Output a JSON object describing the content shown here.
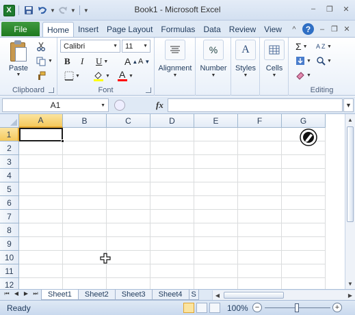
{
  "window": {
    "title": "Book1 - Microsoft Excel",
    "app_icon": "excel-icon",
    "minimize": "–",
    "restore": "❐",
    "close": "✕"
  },
  "qat": {
    "save_icon": "save-icon",
    "undo_icon": "undo-icon",
    "redo_icon": "redo-icon",
    "customize_icon": "customize-qat-icon"
  },
  "ribbon_tabs": {
    "file": "File",
    "tabs": [
      "Home",
      "Insert",
      "Page Layout",
      "Formulas",
      "Data",
      "Review",
      "View"
    ],
    "active": "Home"
  },
  "ribbon": {
    "clipboard": {
      "label": "Clipboard",
      "paste": "Paste"
    },
    "font": {
      "label": "Font",
      "font_name": "Calibri",
      "font_size": "11",
      "bold": "B",
      "italic": "I",
      "underline": "U",
      "grow": "A",
      "shrink": "A",
      "font_color": "A",
      "fill_color": "#ffff00",
      "text_color": "#ff0000"
    },
    "alignment": {
      "label": "Alignment"
    },
    "number": {
      "label": "Number",
      "symbol": "%"
    },
    "styles": {
      "label": "Styles",
      "symbol": "A"
    },
    "cells": {
      "label": "Cells"
    },
    "editing": {
      "label": "Editing",
      "sum": "Σ",
      "sort": "A Z"
    }
  },
  "formula_bar": {
    "name_box": "A1",
    "fx": "fx",
    "formula": ""
  },
  "grid": {
    "columns": [
      "A",
      "B",
      "C",
      "D",
      "E",
      "F",
      "G"
    ],
    "rows": [
      "1",
      "2",
      "3",
      "4",
      "5",
      "6",
      "7",
      "8",
      "9",
      "10",
      "11",
      "12"
    ],
    "active_cell": "A1"
  },
  "sheets": {
    "tabs": [
      "Sheet1",
      "Sheet2",
      "Sheet3",
      "Sheet4",
      "S"
    ],
    "active": "Sheet1"
  },
  "status": {
    "ready": "Ready",
    "zoom": "100%",
    "zoom_minus": "−",
    "zoom_plus": "+"
  }
}
